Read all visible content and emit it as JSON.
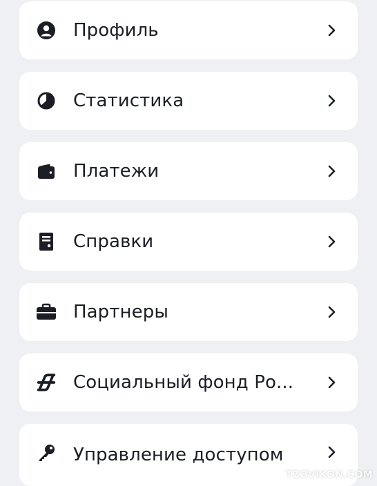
{
  "menu": {
    "items": [
      {
        "label": "Профиль",
        "icon": "user-icon"
      },
      {
        "label": "Статистика",
        "icon": "pie-chart-icon"
      },
      {
        "label": "Платежи",
        "icon": "wallet-icon"
      },
      {
        "label": "Справки",
        "icon": "document-icon"
      },
      {
        "label": "Партнеры",
        "icon": "briefcase-icon"
      },
      {
        "label": "Социальный фонд Ро...",
        "icon": "social-fund-logo-icon"
      },
      {
        "label": "Управление доступом",
        "icon": "key-icon"
      }
    ],
    "chevron_icon": "chevron-right-icon"
  },
  "watermark": {
    "text": "TZOVIKON.COM"
  },
  "colors": {
    "background": "#eef0f3",
    "card": "#ffffff",
    "text": "#1b1e24",
    "icon": "#1b1e24"
  }
}
